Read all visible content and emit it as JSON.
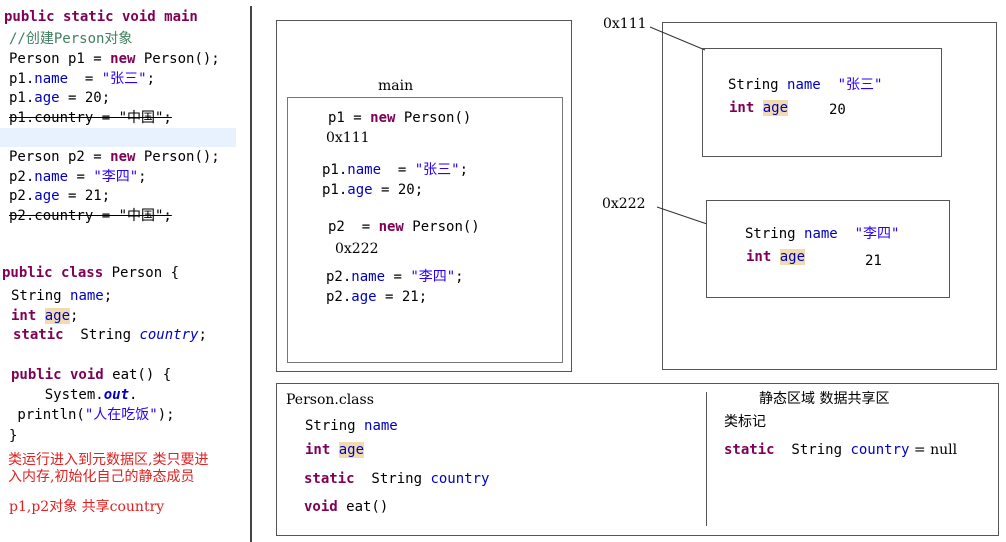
{
  "left_code": {
    "main_sig": "public static void main",
    "comment": "//创建Person对象",
    "p1_new": [
      "Person p1 = ",
      "new",
      " Person();"
    ],
    "p1_name": [
      "p1.",
      "name",
      "  = ",
      "\"张三\"",
      ";"
    ],
    "p1_age": [
      "p1.",
      "age",
      " = 20;"
    ],
    "p1_country": "p1.country = \"中国\";",
    "p2_new": [
      "Person p2 = ",
      "new",
      " Person();"
    ],
    "p2_name": [
      "p2.",
      "name",
      " = ",
      "\"李四\"",
      ";"
    ],
    "p2_age": [
      "p2.",
      "age",
      " = 21;"
    ],
    "p2_country": "p2.country = \"中国\";",
    "class_decl": [
      "public class",
      " Person {"
    ],
    "field_name": [
      "String ",
      "name",
      ";"
    ],
    "field_age": [
      "int",
      " ",
      "age",
      ";"
    ],
    "field_country": [
      "static",
      "  String ",
      "country",
      ";"
    ],
    "method_decl": [
      "public void",
      " eat() {"
    ],
    "method_body1": [
      "    System.",
      "out",
      "."
    ],
    "method_body2": [
      " println(",
      "\"人在吃饭\"",
      ");"
    ],
    "close_brace": "}",
    "note1": "类运行进入到元数据区,类只要进\n入内存,初始化自己的静态成员",
    "note2": "p1,p2对象 共享country"
  },
  "stack": {
    "title": "main",
    "p1_new": [
      "p1 = ",
      "new",
      " Person()"
    ],
    "addr1": "0x111",
    "p1_name": [
      "p1.",
      "name",
      "  = ",
      "\"张三\"",
      ";"
    ],
    "p1_age": [
      "p1.",
      "age",
      " = 20;"
    ],
    "p2_new": [
      "p2  = ",
      "new",
      " Person()"
    ],
    "addr2": "0x222",
    "p2_name": [
      "p2.",
      "name",
      " = ",
      "\"李四\"",
      ";"
    ],
    "p2_age": [
      "p2.",
      "age",
      " = 21;"
    ]
  },
  "heap": {
    "addr1": "0x111",
    "addr2": "0x222",
    "obj1": {
      "name_line": [
        "String ",
        "name",
        "  ",
        "\"张三\""
      ],
      "age_kw": "int",
      "age_field": "age",
      "age_val": "20"
    },
    "obj2": {
      "name_line": [
        "String ",
        "name",
        "  ",
        "\"李四\""
      ],
      "age_kw": "int",
      "age_field": "age",
      "age_val": "21"
    }
  },
  "method_area": {
    "class_title": "Person.class",
    "field_name": [
      "String ",
      "name"
    ],
    "field_age": [
      "int",
      "age"
    ],
    "field_country": [
      "static",
      "  String ",
      "country"
    ],
    "method": [
      "void",
      " eat()"
    ],
    "static_title": "静态区域 数据共享区",
    "class_mark": "类标记",
    "static_country": [
      "static",
      "  String ",
      "country",
      " = null"
    ]
  }
}
